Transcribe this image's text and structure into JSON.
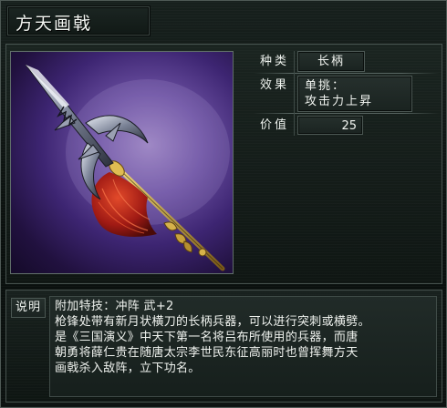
{
  "title": "方天画戟",
  "stats": {
    "type_label": "种类",
    "type_value": "长柄",
    "effect_label": "效果",
    "effect_line1": "单挑：",
    "effect_line2": "攻击力上昇",
    "value_label": "价值",
    "value_value": "25"
  },
  "description": {
    "label": "说明",
    "lines": [
      "附加特技：冲阵 武+2",
      "枪锋处带有新月状横刀的长柄兵器，可以进行突刺或横劈。",
      "是《三国演义》中天下第一名将吕布所使用的兵器，而唐",
      "朝勇将薛仁贵在随唐太宗李世民东征高丽时也曾挥舞方天",
      "画戟杀入敌阵，立下功名。"
    ]
  },
  "colors": {
    "background": "#0a100e",
    "panel_border": "#46524e",
    "text": "#eef2ee",
    "image_bg": "#6a4fa0",
    "tassel": "#b8261c"
  },
  "icons": {
    "item_image": "halberd-weapon-image"
  }
}
